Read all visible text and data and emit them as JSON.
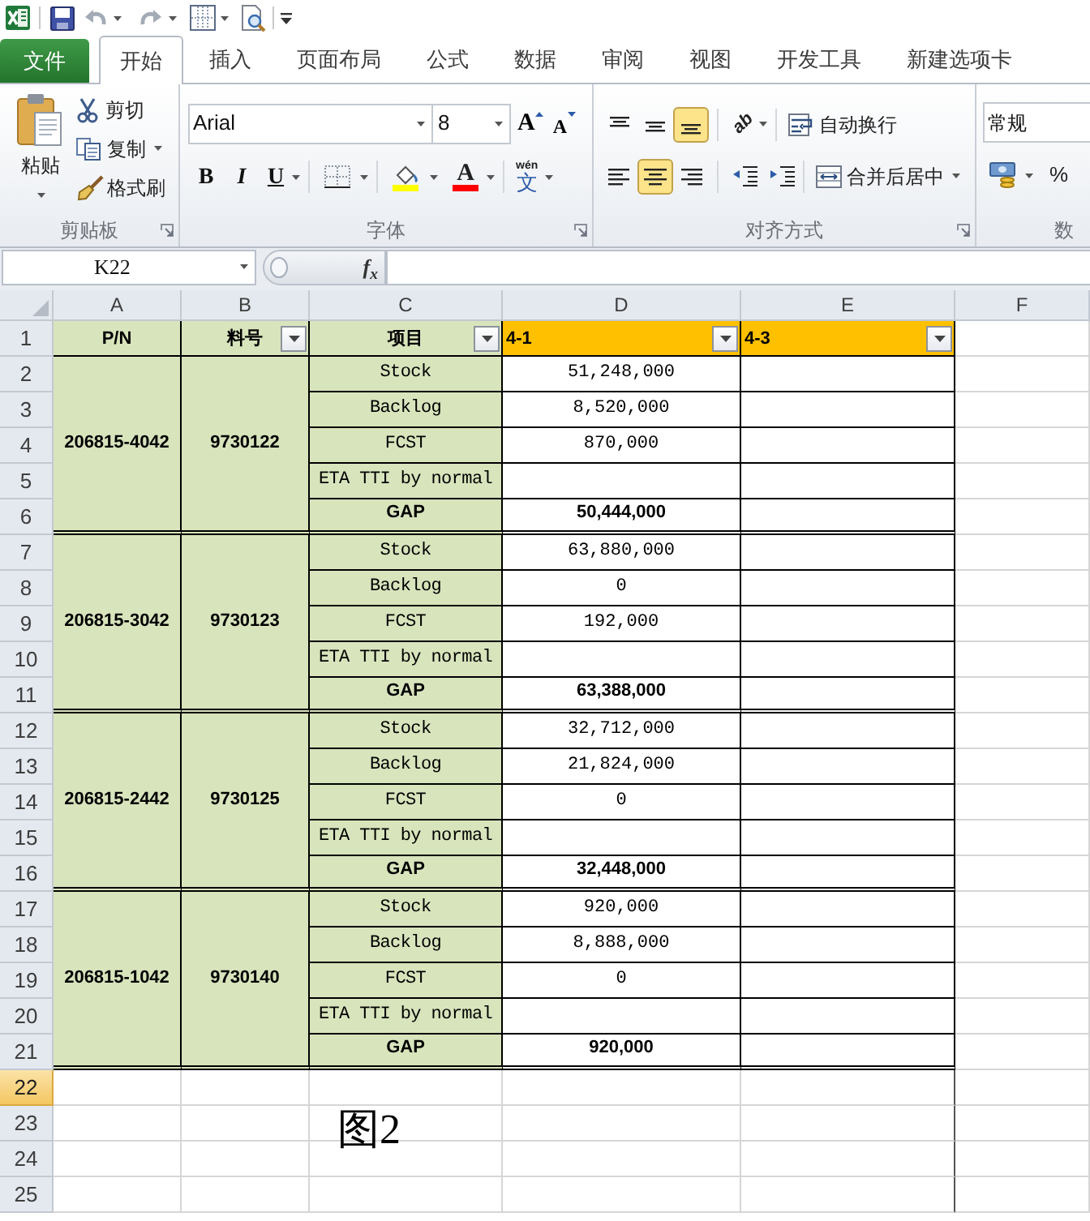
{
  "ribbon_tabs": [
    {
      "label": "文件",
      "kind": "file",
      "selected": false
    },
    {
      "label": "开始",
      "kind": "tab",
      "selected": true
    },
    {
      "label": "插入",
      "kind": "tab",
      "selected": false
    },
    {
      "label": "页面布局",
      "kind": "tab",
      "selected": false
    },
    {
      "label": "公式",
      "kind": "tab",
      "selected": false
    },
    {
      "label": "数据",
      "kind": "tab",
      "selected": false
    },
    {
      "label": "审阅",
      "kind": "tab",
      "selected": false
    },
    {
      "label": "视图",
      "kind": "tab",
      "selected": false
    },
    {
      "label": "开发工具",
      "kind": "tab",
      "selected": false
    },
    {
      "label": "新建选项卡",
      "kind": "tab",
      "selected": false
    }
  ],
  "clipboard": {
    "label": "剪贴板",
    "paste": "粘贴",
    "cut": "剪切",
    "copy": "复制",
    "format_painter": "格式刷"
  },
  "font": {
    "label": "字体",
    "font_name": "Arial",
    "font_size": "8",
    "grow": "A",
    "shrink": "A",
    "bold": "B",
    "italic": "I",
    "underline": "U",
    "font_color": "A",
    "phonetic_top": "wén",
    "phonetic_char": "文"
  },
  "alignment": {
    "label": "对齐方式",
    "vertical": [
      {
        "kind": "top",
        "selected": false
      },
      {
        "kind": "middle",
        "selected": false
      },
      {
        "kind": "bottom",
        "selected": true
      }
    ],
    "orientation": "ab",
    "wrap_text": "自动换行",
    "horizontal": [
      {
        "kind": "left",
        "selected": false
      },
      {
        "kind": "center",
        "selected": true
      },
      {
        "kind": "right",
        "selected": false
      }
    ],
    "merge_center": "合并后居中"
  },
  "number": {
    "label": "数",
    "format": "常规",
    "percent": "%"
  },
  "formula_bar": {
    "name_box": "K22",
    "function_label": "f$_{x}$"
  },
  "sheet": {
    "columns": [
      "A",
      "B",
      "C",
      "D",
      "E",
      "F"
    ],
    "rows": [
      {
        "label": "1",
        "selected": false
      },
      {
        "label": "2",
        "selected": false
      },
      {
        "label": "3",
        "selected": false
      },
      {
        "label": "4",
        "selected": false
      },
      {
        "label": "5",
        "selected": false
      },
      {
        "label": "6",
        "selected": false
      },
      {
        "label": "7",
        "selected": false
      },
      {
        "label": "8",
        "selected": false
      },
      {
        "label": "9",
        "selected": false
      },
      {
        "label": "10",
        "selected": false
      },
      {
        "label": "11",
        "selected": false
      },
      {
        "label": "12",
        "selected": false
      },
      {
        "label": "13",
        "selected": false
      },
      {
        "label": "14",
        "selected": false
      },
      {
        "label": "15",
        "selected": false
      },
      {
        "label": "16",
        "selected": false
      },
      {
        "label": "17",
        "selected": false
      },
      {
        "label": "18",
        "selected": false
      },
      {
        "label": "19",
        "selected": false
      },
      {
        "label": "20",
        "selected": false
      },
      {
        "label": "21",
        "selected": false
      },
      {
        "label": "22",
        "selected": true
      },
      {
        "label": "23",
        "selected": false
      },
      {
        "label": "24",
        "selected": false
      },
      {
        "label": "25",
        "selected": false
      }
    ],
    "header": [
      {
        "text": "P/N",
        "color": "#d8e4bc",
        "filter": false
      },
      {
        "text": "料号",
        "color": "#d8e4bc",
        "filter": true
      },
      {
        "text": "项目",
        "color": "#d8e4bc",
        "filter": true
      },
      {
        "text": "4-1",
        "color": "#ffc000",
        "filter": true
      },
      {
        "text": "4-3",
        "color": "#ffc000",
        "filter": true
      }
    ],
    "groups": [
      {
        "part_no": "206815-4042",
        "material": "9730122",
        "items": [
          {
            "kind": "metric",
            "label": "Stock",
            "value": "51,248,000"
          },
          {
            "kind": "metric",
            "label": "Backlog",
            "value": "8,520,000"
          },
          {
            "kind": "metric",
            "label": "FCST",
            "value": "870,000"
          },
          {
            "kind": "metric",
            "label": "ETA TTI by normal"
          },
          {
            "kind": "total",
            "label": "GAP",
            "value": "50,444,000"
          }
        ]
      },
      {
        "part_no": "206815-3042",
        "material": "9730123",
        "items": [
          {
            "kind": "metric",
            "label": "Stock",
            "value": "63,880,000"
          },
          {
            "kind": "metric",
            "label": "Backlog",
            "value": "0"
          },
          {
            "kind": "metric",
            "label": "FCST",
            "value": "192,000"
          },
          {
            "kind": "metric",
            "label": "ETA TTI by normal"
          },
          {
            "kind": "total",
            "label": "GAP",
            "value": "63,388,000"
          }
        ]
      },
      {
        "part_no": "206815-2442",
        "material": "9730125",
        "items": [
          {
            "kind": "metric",
            "label": "Stock",
            "value": "32,712,000"
          },
          {
            "kind": "metric",
            "label": "Backlog",
            "value": "21,824,000"
          },
          {
            "kind": "metric",
            "label": "FCST",
            "value": "0"
          },
          {
            "kind": "metric",
            "label": "ETA TTI by normal"
          },
          {
            "kind": "total",
            "label": "GAP",
            "value": "32,448,000"
          }
        ]
      },
      {
        "part_no": "206815-1042",
        "material": "9730140",
        "items": [
          {
            "kind": "metric",
            "label": "Stock",
            "value": "920,000"
          },
          {
            "kind": "metric",
            "label": "Backlog",
            "value": "8,888,000"
          },
          {
            "kind": "metric",
            "label": "FCST",
            "value": "0"
          },
          {
            "kind": "metric",
            "label": "ETA TTI by normal"
          },
          {
            "kind": "total",
            "label": "GAP",
            "value": "920,000"
          }
        ]
      }
    ],
    "annotation": "图2"
  }
}
